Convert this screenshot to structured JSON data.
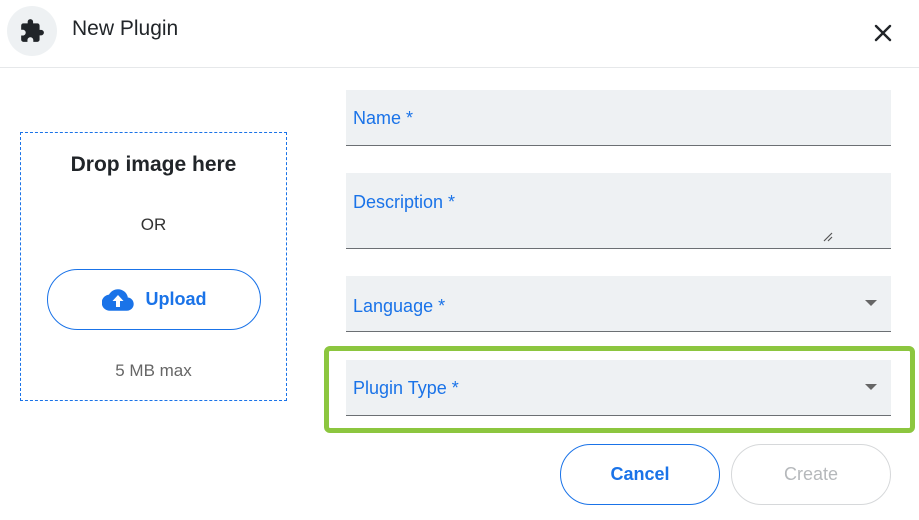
{
  "header": {
    "title": "New Plugin",
    "icon": "puzzle-icon",
    "close_icon": "close-icon"
  },
  "dropzone": {
    "title": "Drop image here",
    "or_text": "OR",
    "upload_label": "Upload",
    "upload_icon": "cloud-upload-icon",
    "max_size": "5 MB max"
  },
  "form": {
    "name_label": "Name *",
    "description_label": "Description *",
    "language_label": "Language *",
    "plugin_type_label": "Plugin Type *"
  },
  "actions": {
    "cancel_label": "Cancel",
    "create_label": "Create"
  },
  "colors": {
    "accent": "#1a73e8",
    "highlight": "#8cc63f",
    "field_bg": "#eef1f3",
    "disabled": "#b5b8bb"
  }
}
